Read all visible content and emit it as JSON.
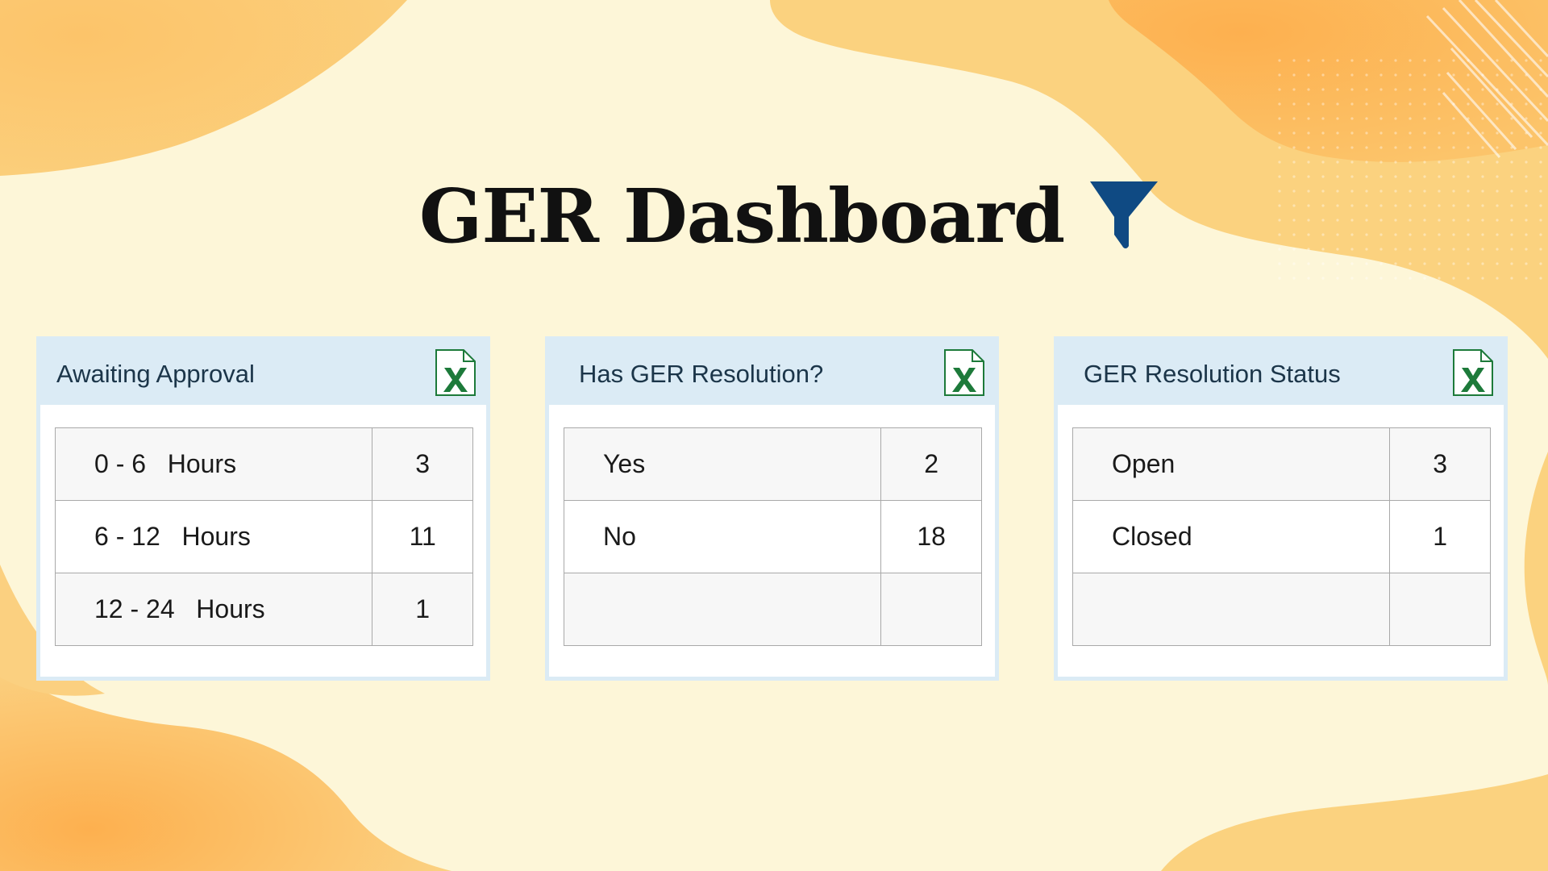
{
  "header": {
    "title": "GER Dashboard",
    "filter_icon": "filter-funnel-icon",
    "filter_color": "#0f4a83"
  },
  "colors": {
    "background_light": "#fdf6d8",
    "blob_mid": "#fbd381",
    "blob_dark": "#fdb55a",
    "card_header": "#dbebf5",
    "excel_green": "#1d7a3a"
  },
  "cards": [
    {
      "title": "Awaiting Approval",
      "export_icon": "excel-file-icon",
      "rows": [
        {
          "label": "0 - 6   Hours",
          "value": "3"
        },
        {
          "label": "6 - 12   Hours",
          "value": "11"
        },
        {
          "label": "12 - 24   Hours",
          "value": "1"
        }
      ]
    },
    {
      "title": "Has GER Resolution?",
      "export_icon": "excel-file-icon",
      "rows": [
        {
          "label": "Yes",
          "value": "2"
        },
        {
          "label": "No",
          "value": "18"
        },
        {
          "label": "",
          "value": ""
        }
      ]
    },
    {
      "title": "GER Resolution Status",
      "export_icon": "excel-file-icon",
      "rows": [
        {
          "label": "Open",
          "value": "3"
        },
        {
          "label": "Closed",
          "value": "1"
        },
        {
          "label": "",
          "value": ""
        }
      ]
    }
  ]
}
